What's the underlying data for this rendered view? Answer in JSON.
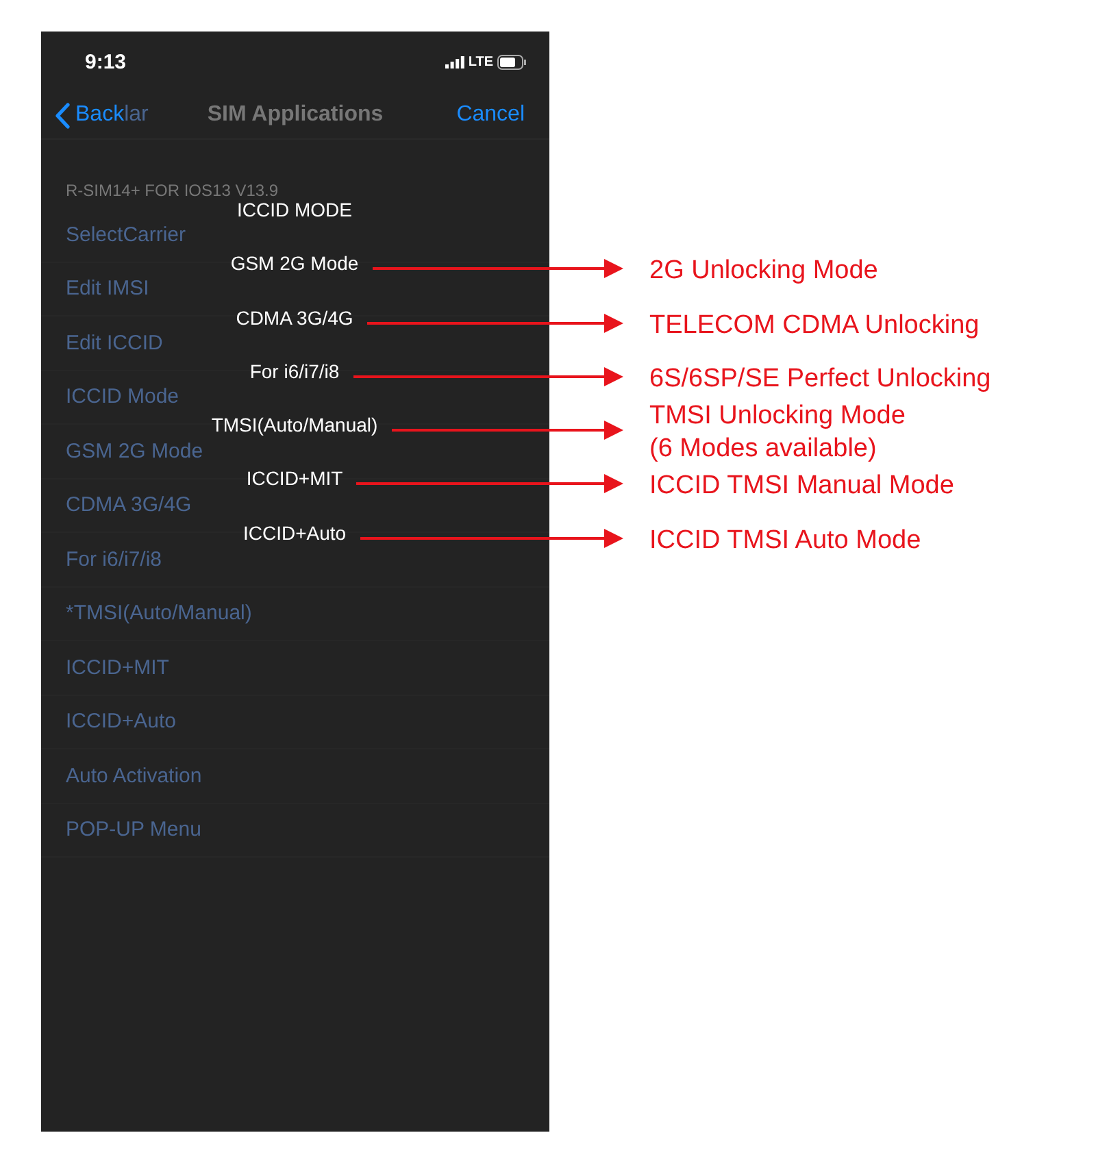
{
  "status_bar": {
    "time": "9:13",
    "network": "LTE"
  },
  "nav_bar": {
    "back": "Back",
    "back_title_tail": "lar",
    "title": "SIM Applications",
    "cancel": "Cancel"
  },
  "list": {
    "header": "R-SIM14+ FOR IOS13  V13.9",
    "items": [
      {
        "label": "SelectCarrier"
      },
      {
        "label": "Edit IMSI"
      },
      {
        "label": "Edit ICCID"
      },
      {
        "label": "ICCID Mode"
      },
      {
        "label": "GSM 2G Mode"
      },
      {
        "label": "CDMA 3G/4G"
      },
      {
        "label": "For i6/i7/i8"
      },
      {
        "label": "*TMSI(Auto/Manual)"
      },
      {
        "label": "ICCID+MIT"
      },
      {
        "label": "ICCID+Auto"
      },
      {
        "label": "Auto Activation"
      },
      {
        "label": "POP-UP Menu"
      }
    ]
  },
  "overlay_menu": [
    {
      "label": "ICCID MODE"
    },
    {
      "label": "GSM 2G  Mode",
      "note": "2G Unlocking Mode"
    },
    {
      "label": "CDMA 3G/4G",
      "note": "TELECOM CDMA Unlocking"
    },
    {
      "label": "For i6/i7/i8",
      "note": "6S/6SP/SE Perfect Unlocking"
    },
    {
      "label": "TMSI(Auto/Manual)",
      "note": "TMSI Unlocking Mode\n(6 Modes available)"
    },
    {
      "label": "ICCID+MIT",
      "note": "ICCID TMSI Manual Mode"
    },
    {
      "label": "ICCID+Auto",
      "note": "ICCID TMSI Auto Mode"
    }
  ]
}
